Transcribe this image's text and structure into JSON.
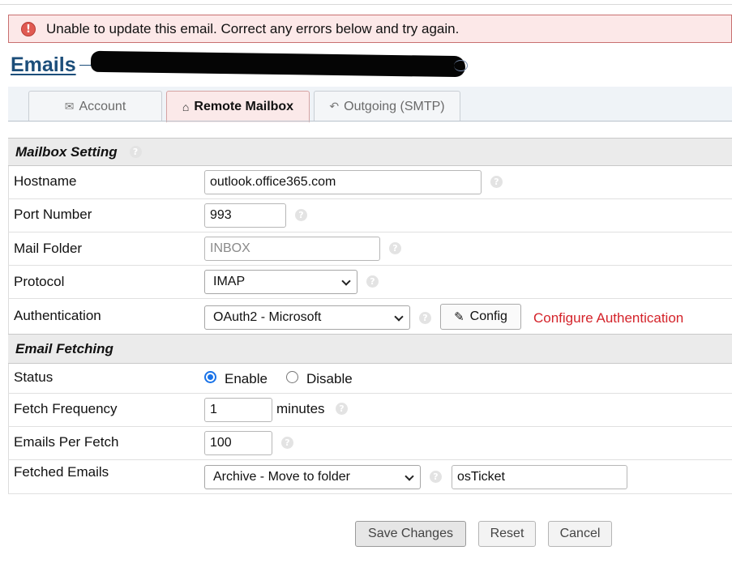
{
  "alert": {
    "icon": "alert-icon",
    "glyph": "!",
    "message": "Unable to update this email. Correct any errors below and try again."
  },
  "page": {
    "title": "Emails"
  },
  "tabs": [
    {
      "label": "Account",
      "icon": "envelope-icon",
      "glyph": "✉",
      "active": false
    },
    {
      "label": "Remote Mailbox",
      "icon": "inbox-icon",
      "glyph": "⌂",
      "active": true
    },
    {
      "label": "Outgoing (SMTP)",
      "icon": "reply-icon",
      "glyph": "↶",
      "active": false
    }
  ],
  "help_glyph": "?",
  "mailbox_section": {
    "title": "Mailbox Setting",
    "hostname": {
      "label": "Hostname",
      "value": "outlook.office365.com"
    },
    "port": {
      "label": "Port Number",
      "value": "993"
    },
    "folder": {
      "label": "Mail Folder",
      "value": "",
      "placeholder": "INBOX"
    },
    "protocol": {
      "label": "Protocol",
      "value": "IMAP"
    },
    "authentication": {
      "label": "Authentication",
      "value": "OAuth2 - Microsoft",
      "config_label": "Config",
      "config_glyph": "✎",
      "config_link": "Configure Authentication"
    }
  },
  "fetching_section": {
    "title": "Email Fetching",
    "status": {
      "label": "Status",
      "options": [
        "Enable",
        "Disable"
      ],
      "selected": "Enable"
    },
    "frequency": {
      "label": "Fetch Frequency",
      "value": "1",
      "suffix": "minutes"
    },
    "per_fetch": {
      "label": "Emails Per Fetch",
      "value": "100"
    },
    "fetched": {
      "label": "Fetched Emails",
      "action": "Archive - Move to folder",
      "folder": "osTicket"
    }
  },
  "buttons": {
    "save": "Save Changes",
    "reset": "Reset",
    "cancel": "Cancel"
  },
  "colors": {
    "alert_bg": "#fce8e8",
    "link": "#1c4e7a",
    "error_text": "#d4232a",
    "radio_accent": "#1a73e8"
  }
}
